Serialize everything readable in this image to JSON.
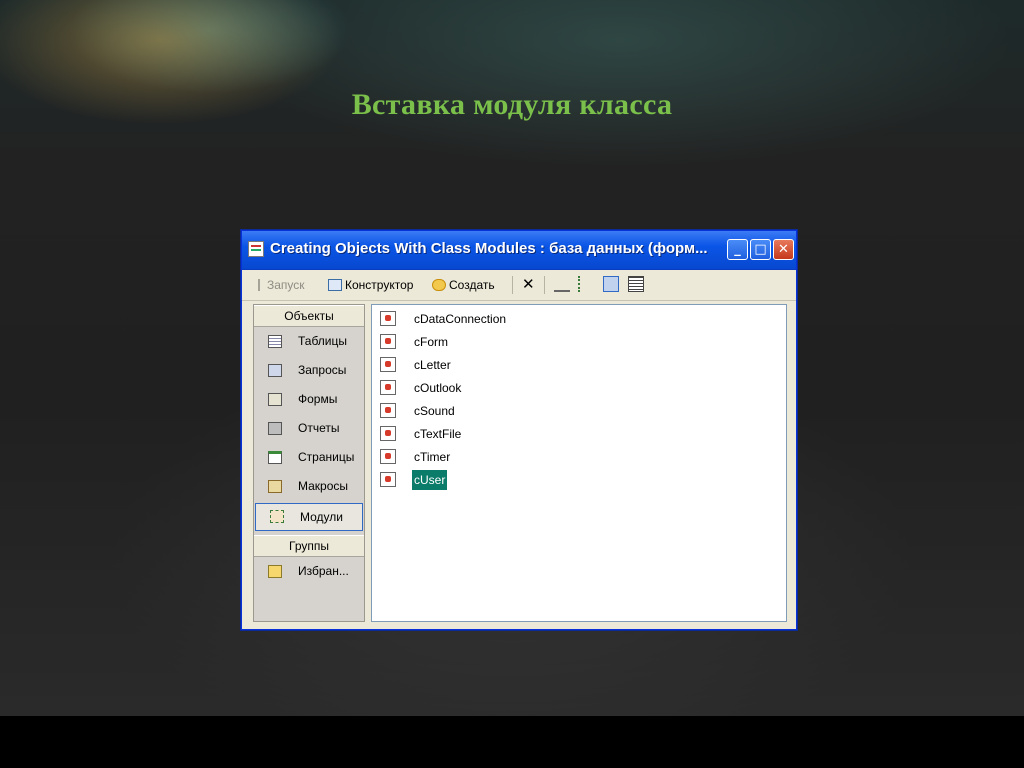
{
  "slide": {
    "title": "Вставка модуля класса"
  },
  "window": {
    "title": "Creating Objects With Class Modules : база данных (форм...",
    "controls": {
      "minimize": "_",
      "maximize": "□",
      "close": "✕"
    }
  },
  "toolbar": {
    "run_label": "Запуск",
    "design_label": "Конструктор",
    "create_label": "Создать",
    "delete_icon": "delete-icon",
    "view_icons": [
      "large-icons-view-icon",
      "small-icons-view-icon",
      "list-view-icon",
      "details-view-icon"
    ],
    "active_view": "list-view-icon"
  },
  "objects_bar": {
    "header": "Объекты",
    "items": [
      {
        "label": "Таблицы",
        "icon": "table-icon"
      },
      {
        "label": "Запросы",
        "icon": "query-icon"
      },
      {
        "label": "Формы",
        "icon": "form-icon"
      },
      {
        "label": "Отчеты",
        "icon": "report-icon"
      },
      {
        "label": "Страницы",
        "icon": "page-icon"
      },
      {
        "label": "Макросы",
        "icon": "macro-icon"
      },
      {
        "label": "Модули",
        "icon": "module-icon",
        "selected": true
      }
    ],
    "groups_header": "Группы",
    "groups": [
      {
        "label": "Избран...",
        "icon": "favorites-folder-icon"
      }
    ]
  },
  "modules": [
    {
      "name": "cDataConnection"
    },
    {
      "name": "cForm"
    },
    {
      "name": "cLetter"
    },
    {
      "name": "cOutlook"
    },
    {
      "name": "cSound"
    },
    {
      "name": "cTextFile"
    },
    {
      "name": "cTimer"
    },
    {
      "name": "cUser",
      "selected": true
    }
  ],
  "colors": {
    "title_green": "#7ac04a",
    "titlebar_blue": "#0a55e6",
    "selection": "#0b7c6a"
  }
}
